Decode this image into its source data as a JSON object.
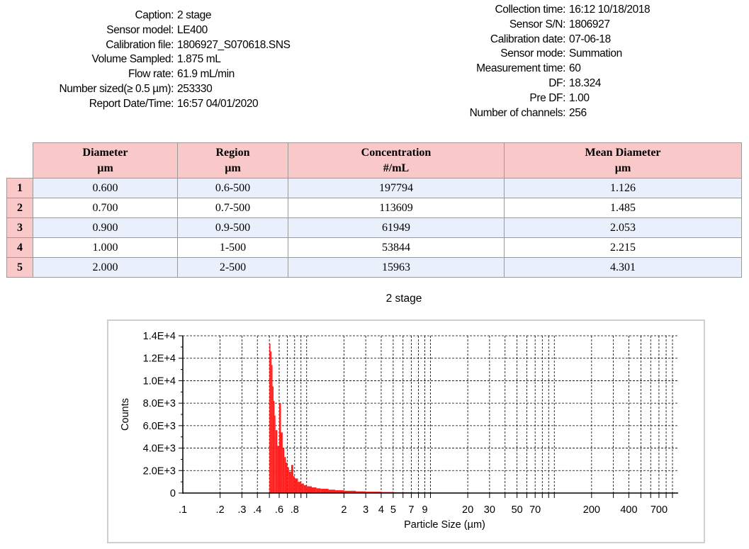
{
  "header_left": [
    {
      "label": "Caption:",
      "value": "2 stage"
    },
    {
      "label": "Sensor model:",
      "value": "LE400"
    },
    {
      "label": "Calibration file:",
      "value": "1806927_S070618.SNS"
    },
    {
      "label": "Volume Sampled:",
      "value": "1.875 mL"
    },
    {
      "label": "Flow rate:",
      "value": "61.9 mL/min"
    },
    {
      "label": "Number sized(≥ 0.5 µm):",
      "value": "253330"
    },
    {
      "label": "Report Date/Time:",
      "value": "16:57 04/01/2020"
    }
  ],
  "header_right": [
    {
      "label": "Collection time:",
      "value": "16:12 10/18/2018"
    },
    {
      "label": "Sensor S/N:",
      "value": "1806927"
    },
    {
      "label": "Calibration date:",
      "value": "07-06-18"
    },
    {
      "label": "Sensor mode:",
      "value": "Summation"
    },
    {
      "label": "Measurement time:",
      "value": "60"
    },
    {
      "label": "DF:",
      "value": "18.324"
    },
    {
      "label": "Pre DF:",
      "value": "1.00"
    },
    {
      "label": "Number of channels:",
      "value": "256"
    }
  ],
  "table": {
    "headers": [
      {
        "title": "Diameter",
        "unit": "µm"
      },
      {
        "title": "Region",
        "unit": "µm"
      },
      {
        "title": "Concentration",
        "unit": "#/mL"
      },
      {
        "title": "Mean Diameter",
        "unit": "µm"
      }
    ],
    "rows": [
      {
        "index": "1",
        "cells": [
          "0.600",
          "0.6-500",
          "197794",
          "1.126"
        ]
      },
      {
        "index": "2",
        "cells": [
          "0.700",
          "0.7-500",
          "113609",
          "1.485"
        ]
      },
      {
        "index": "3",
        "cells": [
          "0.900",
          "0.9-500",
          "61949",
          "2.053"
        ]
      },
      {
        "index": "4",
        "cells": [
          "1.000",
          "1-500",
          "53844",
          "2.215"
        ]
      },
      {
        "index": "5",
        "cells": [
          "2.000",
          "2-500",
          "15963",
          "4.301"
        ]
      }
    ]
  },
  "chart_data": {
    "type": "bar",
    "title": "2 stage",
    "xlabel": "Particle Size (µm)",
    "ylabel": "Counts",
    "xscale": "log",
    "xlim": [
      0.1,
      1000
    ],
    "ylim": [
      0,
      14000
    ],
    "grid": true,
    "color": "#ff2020",
    "ytick_labels": [
      {
        "value": 0,
        "label": "0"
      },
      {
        "value": 2000,
        "label": "2.0E+3"
      },
      {
        "value": 4000,
        "label": "4.0E+3"
      },
      {
        "value": 6000,
        "label": "6.0E+3"
      },
      {
        "value": 8000,
        "label": "8.0E+3"
      },
      {
        "value": 10000,
        "label": "1.0E+4"
      },
      {
        "value": 12000,
        "label": "1.2E+4"
      },
      {
        "value": 14000,
        "label": "1.4E+4"
      }
    ],
    "xtick_labels": [
      {
        "value": 0.1,
        "label": ".1"
      },
      {
        "value": 0.2,
        "label": ".2"
      },
      {
        "value": 0.3,
        "label": ".3"
      },
      {
        "value": 0.4,
        "label": ".4"
      },
      {
        "value": 0.6,
        "label": ".6"
      },
      {
        "value": 0.8,
        "label": ".8"
      },
      {
        "value": 2,
        "label": "2"
      },
      {
        "value": 3,
        "label": "3"
      },
      {
        "value": 4,
        "label": "4"
      },
      {
        "value": 5,
        "label": "5"
      },
      {
        "value": 7,
        "label": "7"
      },
      {
        "value": 9,
        "label": "9"
      },
      {
        "value": 20,
        "label": "20"
      },
      {
        "value": 30,
        "label": "30"
      },
      {
        "value": 50,
        "label": "50"
      },
      {
        "value": 70,
        "label": "70"
      },
      {
        "value": 200,
        "label": "200"
      },
      {
        "value": 400,
        "label": "400"
      },
      {
        "value": 700,
        "label": "700"
      }
    ],
    "x": [
      0.5,
      0.51,
      0.52,
      0.53,
      0.54,
      0.55,
      0.56,
      0.58,
      0.6,
      0.62,
      0.64,
      0.66,
      0.68,
      0.7,
      0.72,
      0.75,
      0.78,
      0.8,
      0.85,
      0.9,
      0.95,
      1.0,
      1.1,
      1.2,
      1.3,
      1.5,
      1.7,
      2.0,
      2.5,
      3.0,
      4.0,
      5.0,
      7.0,
      10,
      20,
      50,
      100
    ],
    "values": [
      13300,
      12600,
      11400,
      9500,
      8200,
      6900,
      5600,
      4200,
      8000,
      5400,
      4000,
      3200,
      2700,
      2300,
      1900,
      2500,
      1500,
      1300,
      1000,
      850,
      700,
      600,
      500,
      420,
      380,
      300,
      250,
      200,
      150,
      120,
      90,
      70,
      50,
      40,
      25,
      15,
      10
    ]
  }
}
